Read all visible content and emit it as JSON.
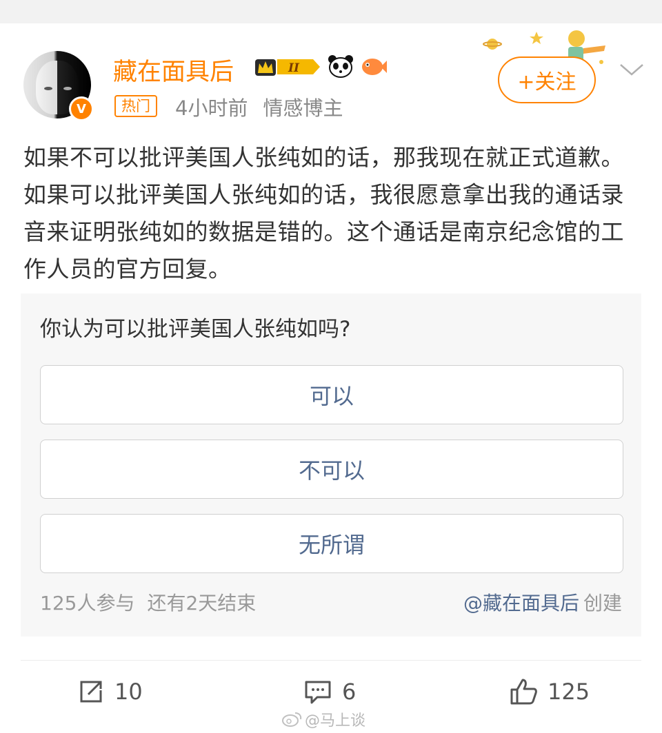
{
  "author": {
    "name": "藏在面具后",
    "verified_badge": "V",
    "hot_tag": "热门",
    "time": "4小时前",
    "category": "情感博主",
    "level_badge": "II"
  },
  "follow_button": {
    "label": "+关注"
  },
  "post": {
    "text": "如果不可以批评美国人张纯如的话，那我现在就正式道歉。如果可以批评美国人张纯如的话，我很愿意拿出我的通话录音来证明张纯如的数据是错的。这个通话是南京纪念馆的工作人员的官方回复。"
  },
  "poll": {
    "question": "你认为可以批评美国人张纯如吗?",
    "options": [
      "可以",
      "不可以",
      "无所谓"
    ],
    "participants": "125人参与",
    "remaining": "还有2天结束",
    "creator": "@藏在面具后",
    "creator_suffix": "创建"
  },
  "actions": {
    "repost_count": "10",
    "comment_count": "6",
    "like_count": "125"
  },
  "watermark": "@马上谈",
  "colors": {
    "accent": "#ff8200",
    "link": "#526a8f",
    "muted": "#999999"
  },
  "icons": [
    "verified-v-icon",
    "crown-badge-icon",
    "panda-icon",
    "fish-icon",
    "chevron-down-icon",
    "repost-icon",
    "comment-icon",
    "like-icon",
    "weibo-logo-icon"
  ]
}
